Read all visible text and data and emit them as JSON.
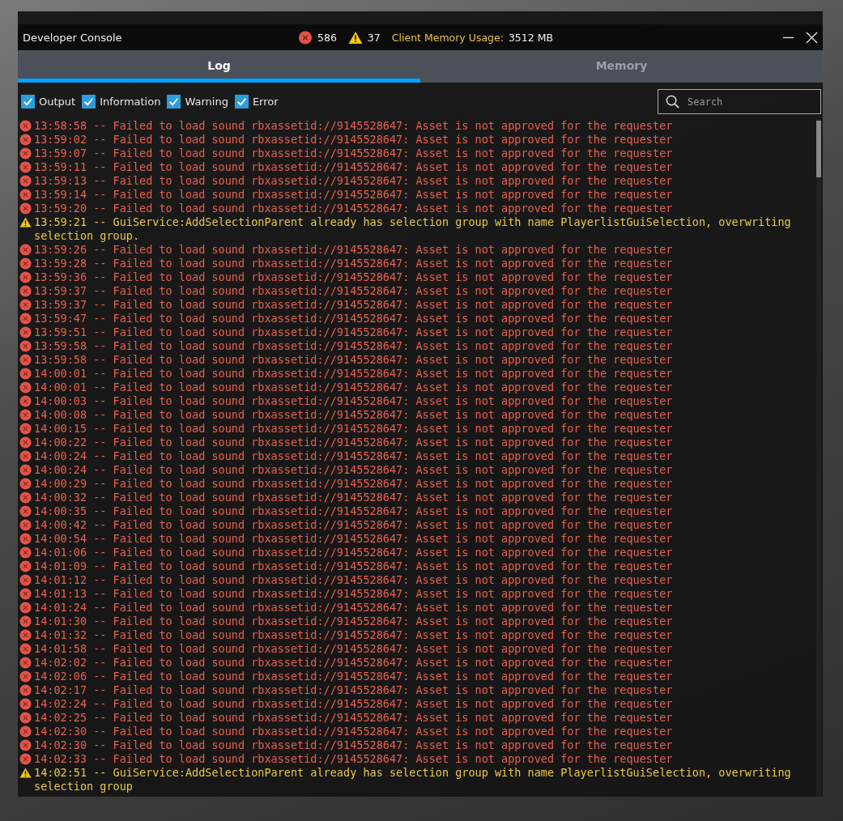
{
  "window": {
    "title": "Developer Console"
  },
  "header": {
    "error_count": "586",
    "warning_count": "37",
    "memory_label": "Client Memory Usage:",
    "memory_value": "3512 MB"
  },
  "tabs": [
    {
      "label": "Log",
      "selected": true
    },
    {
      "label": "Memory",
      "selected": false
    }
  ],
  "filters": [
    {
      "label": "Output",
      "checked": true
    },
    {
      "label": "Information",
      "checked": true
    },
    {
      "label": "Warning",
      "checked": true
    },
    {
      "label": "Error",
      "checked": true
    }
  ],
  "search": {
    "placeholder": "Search"
  },
  "log": [
    {
      "kind": "error",
      "text": "13:58:58 -- Failed to load sound rbxassetid://9145528647: Asset is not approved for the requester"
    },
    {
      "kind": "error",
      "text": "13:59:02 -- Failed to load sound rbxassetid://9145528647: Asset is not approved for the requester"
    },
    {
      "kind": "error",
      "text": "13:59:07 -- Failed to load sound rbxassetid://9145528647: Asset is not approved for the requester"
    },
    {
      "kind": "error",
      "text": "13:59:11 -- Failed to load sound rbxassetid://9145528647: Asset is not approved for the requester"
    },
    {
      "kind": "error",
      "text": "13:59:13 -- Failed to load sound rbxassetid://9145528647: Asset is not approved for the requester"
    },
    {
      "kind": "error",
      "text": "13:59:14 -- Failed to load sound rbxassetid://9145528647: Asset is not approved for the requester"
    },
    {
      "kind": "error",
      "text": "13:59:20 -- Failed to load sound rbxassetid://9145528647: Asset is not approved for the requester"
    },
    {
      "kind": "warning",
      "text": "13:59:21 -- GuiService:AddSelectionParent already has selection group with name PlayerlistGuiSelection, overwriting selection group."
    },
    {
      "kind": "error",
      "text": "13:59:26 -- Failed to load sound rbxassetid://9145528647: Asset is not approved for the requester"
    },
    {
      "kind": "error",
      "text": "13:59:28 -- Failed to load sound rbxassetid://9145528647: Asset is not approved for the requester"
    },
    {
      "kind": "error",
      "text": "13:59:36 -- Failed to load sound rbxassetid://9145528647: Asset is not approved for the requester"
    },
    {
      "kind": "error",
      "text": "13:59:37 -- Failed to load sound rbxassetid://9145528647: Asset is not approved for the requester"
    },
    {
      "kind": "error",
      "text": "13:59:37 -- Failed to load sound rbxassetid://9145528647: Asset is not approved for the requester"
    },
    {
      "kind": "error",
      "text": "13:59:47 -- Failed to load sound rbxassetid://9145528647: Asset is not approved for the requester"
    },
    {
      "kind": "error",
      "text": "13:59:51 -- Failed to load sound rbxassetid://9145528647: Asset is not approved for the requester"
    },
    {
      "kind": "error",
      "text": "13:59:58 -- Failed to load sound rbxassetid://9145528647: Asset is not approved for the requester"
    },
    {
      "kind": "error",
      "text": "13:59:58 -- Failed to load sound rbxassetid://9145528647: Asset is not approved for the requester"
    },
    {
      "kind": "error",
      "text": "14:00:01 -- Failed to load sound rbxassetid://9145528647: Asset is not approved for the requester"
    },
    {
      "kind": "error",
      "text": "14:00:01 -- Failed to load sound rbxassetid://9145528647: Asset is not approved for the requester"
    },
    {
      "kind": "error",
      "text": "14:00:03 -- Failed to load sound rbxassetid://9145528647: Asset is not approved for the requester"
    },
    {
      "kind": "error",
      "text": "14:00:08 -- Failed to load sound rbxassetid://9145528647: Asset is not approved for the requester"
    },
    {
      "kind": "error",
      "text": "14:00:15 -- Failed to load sound rbxassetid://9145528647: Asset is not approved for the requester"
    },
    {
      "kind": "error",
      "text": "14:00:22 -- Failed to load sound rbxassetid://9145528647: Asset is not approved for the requester"
    },
    {
      "kind": "error",
      "text": "14:00:24 -- Failed to load sound rbxassetid://9145528647: Asset is not approved for the requester"
    },
    {
      "kind": "error",
      "text": "14:00:24 -- Failed to load sound rbxassetid://9145528647: Asset is not approved for the requester"
    },
    {
      "kind": "error",
      "text": "14:00:29 -- Failed to load sound rbxassetid://9145528647: Asset is not approved for the requester"
    },
    {
      "kind": "error",
      "text": "14:00:32 -- Failed to load sound rbxassetid://9145528647: Asset is not approved for the requester"
    },
    {
      "kind": "error",
      "text": "14:00:35 -- Failed to load sound rbxassetid://9145528647: Asset is not approved for the requester"
    },
    {
      "kind": "error",
      "text": "14:00:42 -- Failed to load sound rbxassetid://9145528647: Asset is not approved for the requester"
    },
    {
      "kind": "error",
      "text": "14:00:54 -- Failed to load sound rbxassetid://9145528647: Asset is not approved for the requester"
    },
    {
      "kind": "error",
      "text": "14:01:06 -- Failed to load sound rbxassetid://9145528647: Asset is not approved for the requester"
    },
    {
      "kind": "error",
      "text": "14:01:09 -- Failed to load sound rbxassetid://9145528647: Asset is not approved for the requester"
    },
    {
      "kind": "error",
      "text": "14:01:12 -- Failed to load sound rbxassetid://9145528647: Asset is not approved for the requester"
    },
    {
      "kind": "error",
      "text": "14:01:13 -- Failed to load sound rbxassetid://9145528647: Asset is not approved for the requester"
    },
    {
      "kind": "error",
      "text": "14:01:24 -- Failed to load sound rbxassetid://9145528647: Asset is not approved for the requester"
    },
    {
      "kind": "error",
      "text": "14:01:30 -- Failed to load sound rbxassetid://9145528647: Asset is not approved for the requester"
    },
    {
      "kind": "error",
      "text": "14:01:32 -- Failed to load sound rbxassetid://9145528647: Asset is not approved for the requester"
    },
    {
      "kind": "error",
      "text": "14:01:58 -- Failed to load sound rbxassetid://9145528647: Asset is not approved for the requester"
    },
    {
      "kind": "error",
      "text": "14:02:02 -- Failed to load sound rbxassetid://9145528647: Asset is not approved for the requester"
    },
    {
      "kind": "error",
      "text": "14:02:06 -- Failed to load sound rbxassetid://9145528647: Asset is not approved for the requester"
    },
    {
      "kind": "error",
      "text": "14:02:17 -- Failed to load sound rbxassetid://9145528647: Asset is not approved for the requester"
    },
    {
      "kind": "error",
      "text": "14:02:24 -- Failed to load sound rbxassetid://9145528647: Asset is not approved for the requester"
    },
    {
      "kind": "error",
      "text": "14:02:25 -- Failed to load sound rbxassetid://9145528647: Asset is not approved for the requester"
    },
    {
      "kind": "error",
      "text": "14:02:30 -- Failed to load sound rbxassetid://9145528647: Asset is not approved for the requester"
    },
    {
      "kind": "error",
      "text": "14:02:30 -- Failed to load sound rbxassetid://9145528647: Asset is not approved for the requester"
    },
    {
      "kind": "error",
      "text": "14:02:33 -- Failed to load sound rbxassetid://9145528647: Asset is not approved for the requester"
    },
    {
      "kind": "warning",
      "text": "14:02:51 -- GuiService:AddSelectionParent already has selection group with name PlayerlistGuiSelection, overwriting selection group"
    }
  ]
}
